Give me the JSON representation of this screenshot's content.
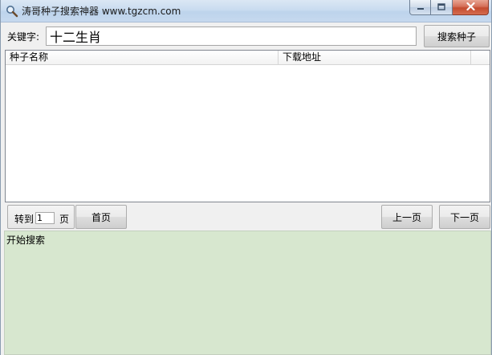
{
  "window": {
    "title": "涛哥种子搜索神器 www.tgzcm.com",
    "icon": "search-icon"
  },
  "search": {
    "keyword_label": "关键字:",
    "keyword_value": "十二生肖",
    "search_button": "搜索种子"
  },
  "results": {
    "columns": [
      "种子名称",
      "下载地址"
    ],
    "rows": []
  },
  "pager": {
    "goto_prefix": "转到",
    "page_value": "1",
    "goto_suffix": "页",
    "first_button": "首页",
    "prev_button": "上一页",
    "next_button": "下一页"
  },
  "log": {
    "text": "开始搜索"
  },
  "colors": {
    "log_background": "#d7e7cf",
    "close_button": "#c44b2f"
  }
}
